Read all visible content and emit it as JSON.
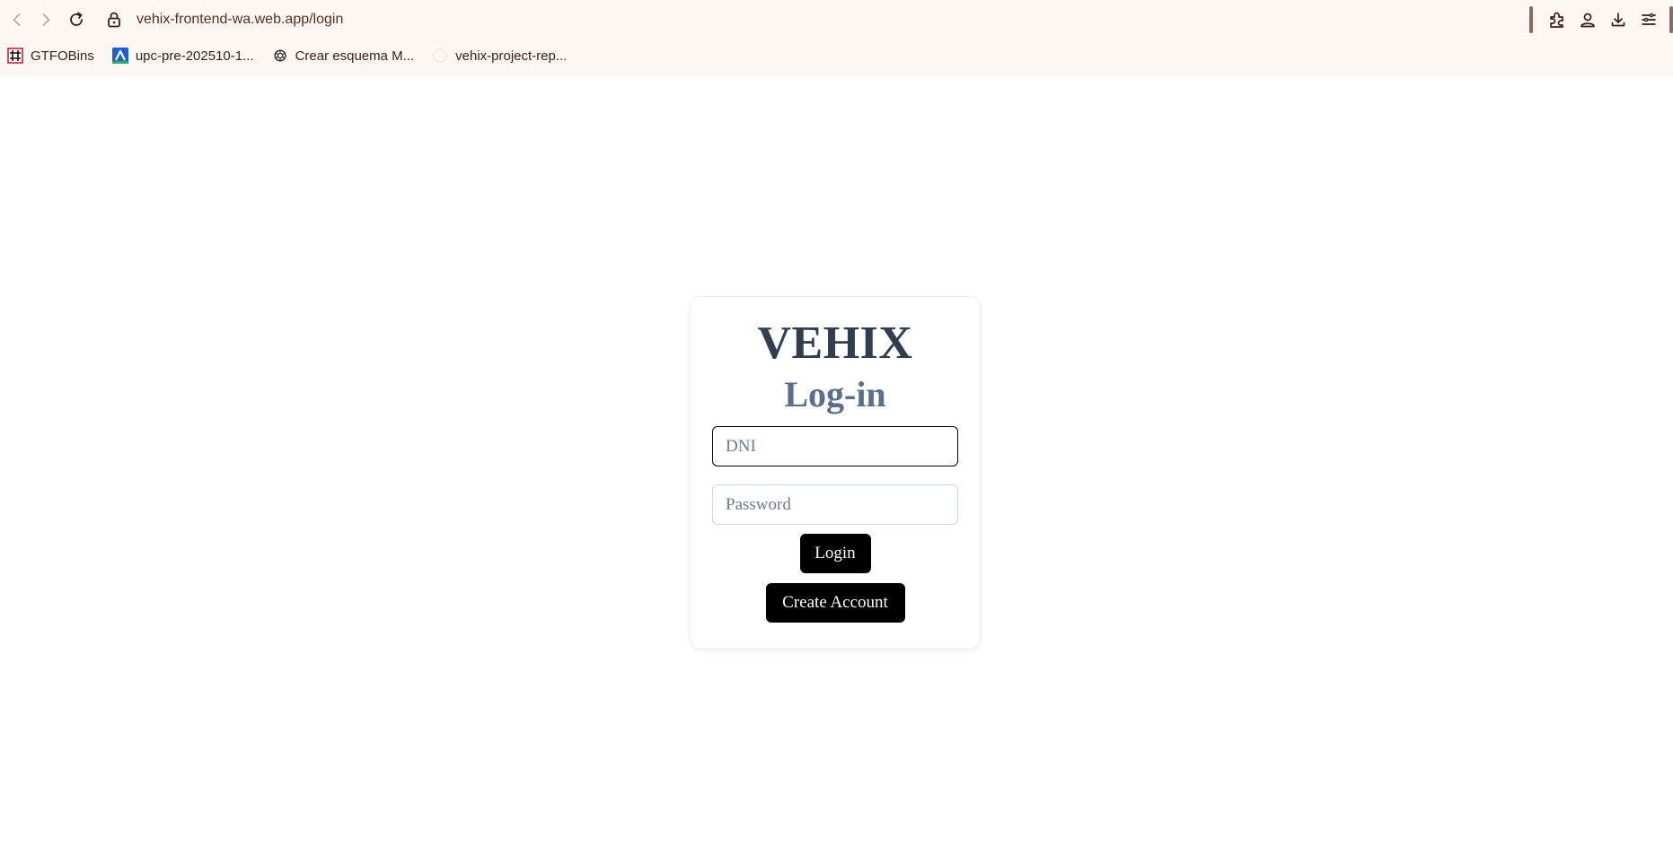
{
  "browser": {
    "url": "vehix-frontend-wa.web.app/login",
    "bookmarks": [
      {
        "label": "GTFOBins",
        "icon": "gtfobins-favicon"
      },
      {
        "label": "upc-pre-202510-1...",
        "icon": "upc-favicon"
      },
      {
        "label": "Crear esquema M...",
        "icon": "openai-favicon"
      },
      {
        "label": "vehix-project-rep...",
        "icon": "github-favicon"
      }
    ],
    "toolbar_icons": [
      "back-icon",
      "forward-icon",
      "reload-icon",
      "lock-icon",
      "extensions-icon",
      "account-icon",
      "download-icon",
      "menu-icon"
    ]
  },
  "login": {
    "brand": "VEHIX",
    "title": "Log-in",
    "dni_placeholder": "DNI",
    "password_placeholder": "Password",
    "login_label": "Login",
    "create_account_label": "Create Account"
  },
  "colors": {
    "chrome_background": "#fdf7f4",
    "brand_text": "#2f3e50",
    "title_text": "#5a6f8b",
    "button_background": "#000000",
    "button_text": "#ffffff"
  }
}
